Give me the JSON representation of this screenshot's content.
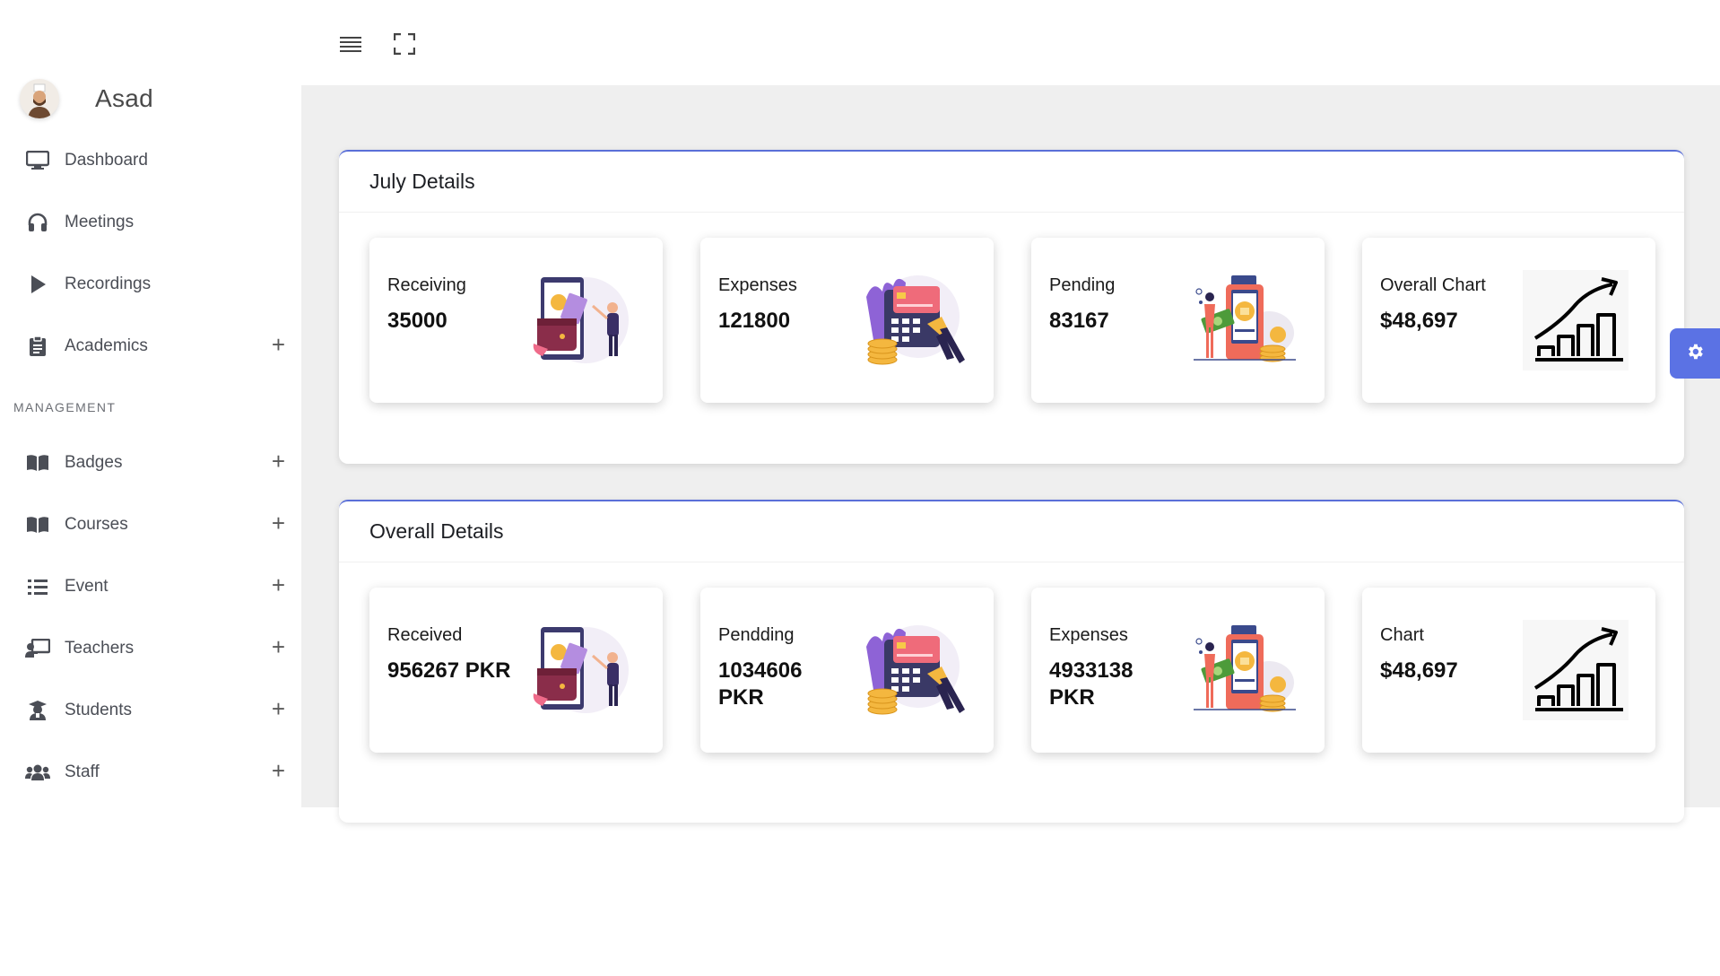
{
  "profile": {
    "name": "Asad"
  },
  "nav": [
    {
      "label": "Dashboard",
      "icon": "monitor-icon",
      "expand": ""
    },
    {
      "label": "Meetings",
      "icon": "headphones-icon",
      "expand": ""
    },
    {
      "label": "Recordings",
      "icon": "play-icon",
      "expand": ""
    },
    {
      "label": "Academics",
      "icon": "clipboard-icon",
      "expand": "+"
    }
  ],
  "management": {
    "section_label": "MANAGEMENT",
    "items": [
      {
        "label": "Badges",
        "icon": "book-icon",
        "expand": "+"
      },
      {
        "label": "Courses",
        "icon": "book-icon",
        "expand": "+"
      },
      {
        "label": "Event",
        "icon": "list-icon",
        "expand": "+"
      },
      {
        "label": "Teachers",
        "icon": "chalkboard-teacher-icon",
        "expand": "+"
      },
      {
        "label": "Students",
        "icon": "graduate-icon",
        "expand": "+"
      },
      {
        "label": "Staff",
        "icon": "users-icon",
        "expand": "+"
      }
    ]
  },
  "topbar": {
    "menu_icon": "hamburger-menu-icon",
    "fullscreen_icon": "fullscreen-icon"
  },
  "panels": [
    {
      "title": "July Details",
      "cards": [
        {
          "label": "Receiving",
          "value": "35000",
          "image": "wallet-phone-illustration"
        },
        {
          "label": "Expenses",
          "value": "121800",
          "image": "credit-card-coins-illustration"
        },
        {
          "label": "Pending",
          "value": "83167",
          "image": "bank-phone-cash-illustration"
        },
        {
          "label": "Overall Chart",
          "value": "$48,697",
          "image": "growth-chart-illustration"
        }
      ]
    },
    {
      "title": "Overall Details",
      "cards": [
        {
          "label": "Received",
          "value": "956267 PKR",
          "image": "wallet-phone-illustration"
        },
        {
          "label": "Pendding",
          "value": "1034606 PKR",
          "image": "credit-card-coins-illustration"
        },
        {
          "label": "Expenses",
          "value": "4933138 PKR",
          "image": "bank-phone-cash-illustration"
        },
        {
          "label": "Chart",
          "value": "$48,697",
          "image": "growth-chart-illustration"
        }
      ]
    }
  ],
  "settings": {
    "icon": "gear-icon"
  },
  "colors": {
    "accent": "#5b72e4",
    "background": "#efefef",
    "sidebar": "#ffffff"
  }
}
